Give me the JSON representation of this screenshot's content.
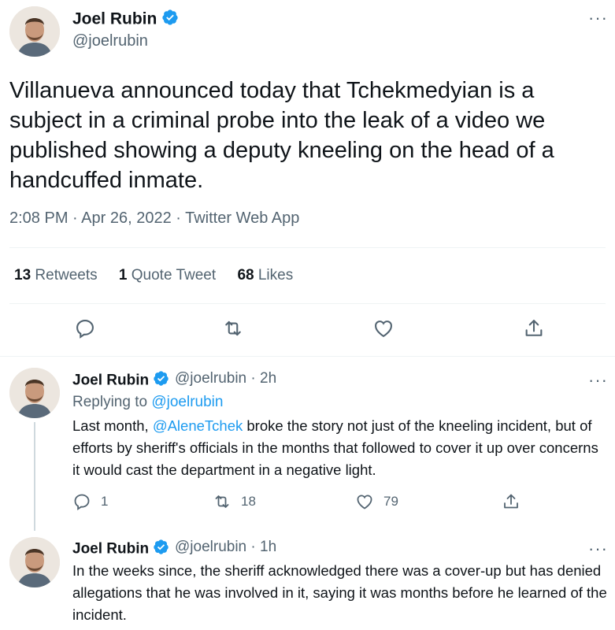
{
  "main_tweet": {
    "author_name": "Joel Rubin",
    "handle": "@joelrubin",
    "text": "Villanueva announced today that Tchekmedyian is a subject in a criminal probe into the leak of a video we published showing a deputy kneeling on the head of a handcuffed inmate.",
    "time": "2:08 PM",
    "date": "Apr 26, 2022",
    "source": "Twitter Web App",
    "separator": " · ",
    "retweets_count": "13",
    "retweets_label": "Retweets",
    "quotes_count": "1",
    "quotes_label": "Quote Tweet",
    "likes_count": "68",
    "likes_label": "Likes"
  },
  "replies": [
    {
      "author_name": "Joel Rubin",
      "handle": "@joelrubin",
      "age": "2h",
      "replying_prefix": "Replying to",
      "replying_to": "@joelrubin",
      "text_before": "Last month, ",
      "mention": "@AleneTchek",
      "text_after": " broke the story not just of the kneeling incident, but of efforts by sheriff's officials in the months that followed to cover it up over concerns it would cast the department in a negative light.",
      "reply_count": "1",
      "retweet_count": "18",
      "like_count": "79"
    },
    {
      "author_name": "Joel Rubin",
      "handle": "@joelrubin",
      "age": "1h",
      "text": "In the weeks since, the sheriff acknowledged there was a cover-up but has denied allegations that he was involved in it, saying it was months before he learned of the incident."
    }
  ],
  "colors": {
    "accent": "#1d9bf0",
    "secondary_text": "#536471",
    "primary_text": "#0f1419"
  },
  "icons": [
    "verified-badge-icon",
    "more-icon",
    "reply-icon",
    "retweet-icon",
    "like-icon",
    "share-icon"
  ]
}
